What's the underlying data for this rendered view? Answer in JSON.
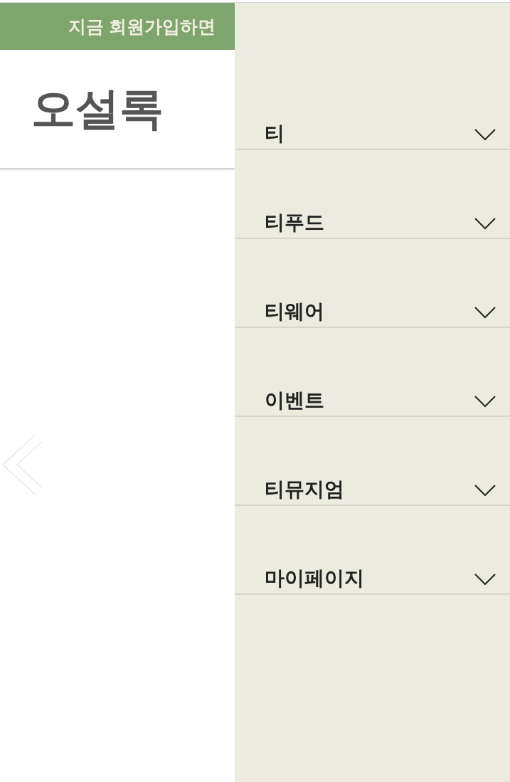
{
  "banner": {
    "text": "지금 회원가입하면"
  },
  "header": {
    "logo": "오설록"
  },
  "menu": {
    "items": [
      {
        "label": "티",
        "expanded": false
      },
      {
        "label": "티푸드",
        "expanded": false
      },
      {
        "label": "티웨어",
        "expanded": false
      },
      {
        "label": "이벤트",
        "expanded": false
      },
      {
        "label": "티뮤지엄",
        "expanded": false
      },
      {
        "label": "마이페이지",
        "expanded": false
      }
    ]
  }
}
